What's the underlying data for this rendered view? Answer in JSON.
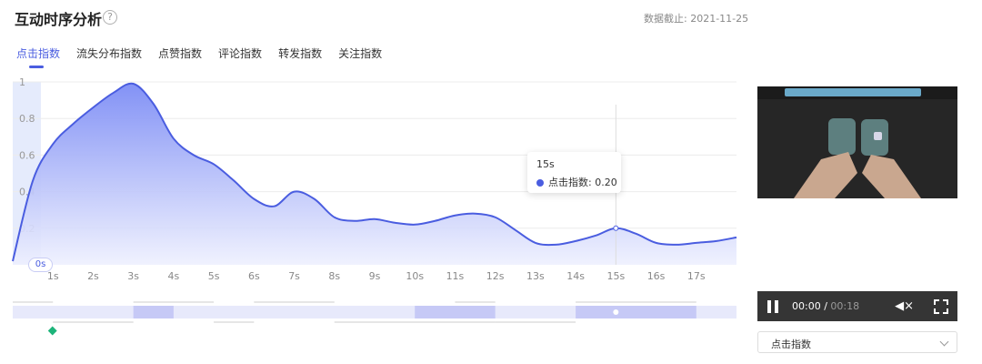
{
  "header": {
    "title": "互动时序分析",
    "help_icon": "?",
    "date_label": "数据截止: 2021-11-25"
  },
  "tabs": [
    {
      "label": "点击指数",
      "active": true
    },
    {
      "label": "流失分布指数",
      "active": false
    },
    {
      "label": "点赞指数",
      "active": false
    },
    {
      "label": "评论指数",
      "active": false
    },
    {
      "label": "转发指数",
      "active": false
    },
    {
      "label": "关注指数",
      "active": false
    }
  ],
  "chart_data": {
    "type": "area",
    "y_ticks": [
      "1",
      "0.8",
      "0.6",
      "0.4",
      "0.2"
    ],
    "x_ticks": [
      "1s",
      "2s",
      "3s",
      "4s",
      "5s",
      "6s",
      "7s",
      "8s",
      "9s",
      "10s",
      "11s",
      "12s",
      "13s",
      "14s",
      "15s",
      "16s",
      "17s"
    ],
    "ylim": [
      0,
      1
    ],
    "xlim": [
      0,
      18
    ],
    "series": [
      {
        "x": [
          0,
          0.5,
          1,
          1.5,
          2,
          2.5,
          3,
          3.5,
          4,
          4.5,
          5,
          5.5,
          6,
          6.5,
          7,
          7.5,
          8,
          8.5,
          9,
          9.5,
          10,
          10.5,
          11,
          11.5,
          12,
          12.5,
          13,
          13.5,
          14,
          14.5,
          15,
          15.5,
          16,
          16.5,
          17,
          17.5,
          18
        ],
        "values": [
          0.02,
          0.46,
          0.66,
          0.77,
          0.86,
          0.94,
          0.99,
          0.88,
          0.69,
          0.6,
          0.55,
          0.46,
          0.36,
          0.32,
          0.4,
          0.36,
          0.26,
          0.24,
          0.25,
          0.23,
          0.22,
          0.24,
          0.27,
          0.28,
          0.26,
          0.19,
          0.12,
          0.11,
          0.13,
          0.16,
          0.2,
          0.17,
          0.12,
          0.11,
          0.12,
          0.13,
          0.15
        ]
      }
    ],
    "highlight_start": "0s",
    "tooltip": {
      "title": "15s",
      "series_label": "点击指数: 0.20",
      "x": 15,
      "y": 0.2
    },
    "grid": true,
    "accent_color": "#4a5de0"
  },
  "video": {
    "time_current": "00:00",
    "time_sep": " / ",
    "time_total": "00:18"
  },
  "metric_select": {
    "value": "点击指数"
  }
}
